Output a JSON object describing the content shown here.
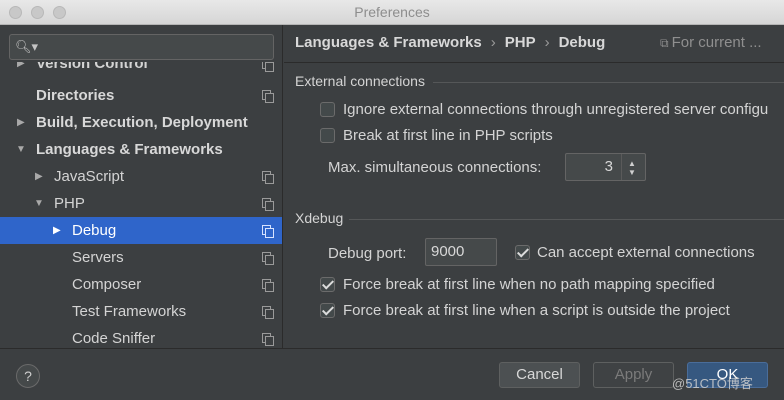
{
  "window": {
    "title": "Preferences"
  },
  "search": {
    "placeholder": ""
  },
  "sidebar": {
    "items": [
      {
        "label": "Version Control"
      },
      {
        "label": "Directories"
      },
      {
        "label": "Build, Execution, Deployment"
      },
      {
        "label": "Languages & Frameworks"
      },
      {
        "label": "JavaScript"
      },
      {
        "label": "PHP"
      },
      {
        "label": "Debug",
        "selected": true
      },
      {
        "label": "Servers"
      },
      {
        "label": "Composer"
      },
      {
        "label": "Test Frameworks"
      },
      {
        "label": "Code Sniffer"
      }
    ]
  },
  "breadcrumb": {
    "part1": "Languages & Frameworks",
    "part2": "PHP",
    "part3": "Debug",
    "separator": "›"
  },
  "header": {
    "scope_label": "For current ..."
  },
  "external": {
    "title": "External connections",
    "ignore_label": "Ignore external connections through unregistered server configu",
    "ignore_checked": false,
    "break_label": "Break at first line in PHP scripts",
    "break_checked": false,
    "max_label": "Max. simultaneous connections:",
    "max_value": "3"
  },
  "xdebug": {
    "title": "Xdebug",
    "port_label": "Debug port:",
    "port_value": "9000",
    "accept_label": "Can accept external connections",
    "accept_checked": true,
    "force_path_label": "Force break at first line when no path mapping specified",
    "force_path_checked": true,
    "force_outside_label": "Force break at first line when a script is outside the project",
    "force_outside_checked": true
  },
  "footer": {
    "help_label": "?",
    "cancel_label": "Cancel",
    "apply_label": "Apply",
    "ok_label": "OK",
    "watermark": "@51CTO博客"
  },
  "colors": {
    "selection": "#2f65ca",
    "background": "#3c3f41",
    "primary_button": "#365880"
  }
}
